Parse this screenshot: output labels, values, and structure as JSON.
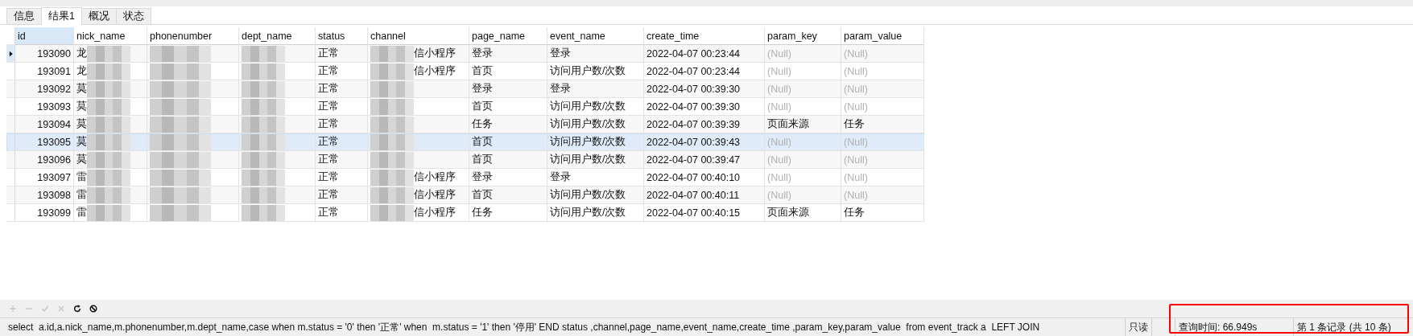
{
  "tabs": [
    {
      "label": "信息",
      "selected": false
    },
    {
      "label": "结果1",
      "selected": true
    },
    {
      "label": "概况",
      "selected": false
    },
    {
      "label": "状态",
      "selected": false
    }
  ],
  "table": {
    "columns": [
      {
        "label": "id",
        "selected": true
      },
      {
        "label": "nick_name",
        "selected": false
      },
      {
        "label": "phonenumber",
        "selected": false
      },
      {
        "label": "dept_name",
        "selected": false
      },
      {
        "label": "status",
        "selected": false
      },
      {
        "label": "channel",
        "selected": false
      },
      {
        "label": "page_name",
        "selected": false
      },
      {
        "label": "event_name",
        "selected": false
      },
      {
        "label": "create_time",
        "selected": false
      },
      {
        "label": "param_key",
        "selected": false
      },
      {
        "label": "param_value",
        "selected": false
      }
    ],
    "rows": [
      {
        "selected": true,
        "highlighted": false,
        "cells": [
          {
            "kind": "number",
            "text": "193090"
          },
          {
            "kind": "text",
            "text": "龙",
            "redacted": true
          },
          {
            "kind": "text",
            "redacted": true
          },
          {
            "kind": "text",
            "redacted": true
          },
          {
            "kind": "text",
            "text": "正常"
          },
          {
            "kind": "text",
            "text": "信小程序",
            "redacted": true
          },
          {
            "kind": "text",
            "text": "登录"
          },
          {
            "kind": "text",
            "text": "登录"
          },
          {
            "kind": "text",
            "text": "2022-04-07 00:23:44"
          },
          {
            "kind": "null",
            "text": "(Null)"
          },
          {
            "kind": "null",
            "text": "(Null)"
          }
        ]
      },
      {
        "selected": false,
        "highlighted": false,
        "cells": [
          {
            "kind": "number",
            "text": "193091"
          },
          {
            "kind": "text",
            "text": "龙",
            "redacted": true
          },
          {
            "kind": "text",
            "redacted": true
          },
          {
            "kind": "text",
            "redacted": true
          },
          {
            "kind": "text",
            "text": "正常"
          },
          {
            "kind": "text",
            "text": "信小程序",
            "redacted": true
          },
          {
            "kind": "text",
            "text": "首页"
          },
          {
            "kind": "text",
            "text": "访问用户数/次数"
          },
          {
            "kind": "text",
            "text": "2022-04-07 00:23:44"
          },
          {
            "kind": "null",
            "text": "(Null)"
          },
          {
            "kind": "null",
            "text": "(Null)"
          }
        ]
      },
      {
        "selected": false,
        "highlighted": false,
        "cells": [
          {
            "kind": "number",
            "text": "193092"
          },
          {
            "kind": "text",
            "text": "莫",
            "redacted": true
          },
          {
            "kind": "text",
            "redacted": true
          },
          {
            "kind": "text",
            "redacted": true
          },
          {
            "kind": "text",
            "text": "正常"
          },
          {
            "kind": "text",
            "redacted": true
          },
          {
            "kind": "text",
            "text": "登录"
          },
          {
            "kind": "text",
            "text": "登录"
          },
          {
            "kind": "text",
            "text": "2022-04-07 00:39:30"
          },
          {
            "kind": "null",
            "text": "(Null)"
          },
          {
            "kind": "null",
            "text": "(Null)"
          }
        ]
      },
      {
        "selected": false,
        "highlighted": false,
        "cells": [
          {
            "kind": "number",
            "text": "193093"
          },
          {
            "kind": "text",
            "text": "莫",
            "redacted": true
          },
          {
            "kind": "text",
            "redacted": true
          },
          {
            "kind": "text",
            "redacted": true
          },
          {
            "kind": "text",
            "text": "正常"
          },
          {
            "kind": "text",
            "redacted": true
          },
          {
            "kind": "text",
            "text": "首页"
          },
          {
            "kind": "text",
            "text": "访问用户数/次数"
          },
          {
            "kind": "text",
            "text": "2022-04-07 00:39:30"
          },
          {
            "kind": "null",
            "text": "(Null)"
          },
          {
            "kind": "null",
            "text": "(Null)"
          }
        ]
      },
      {
        "selected": false,
        "highlighted": false,
        "cells": [
          {
            "kind": "number",
            "text": "193094"
          },
          {
            "kind": "text",
            "text": "莫",
            "redacted": true
          },
          {
            "kind": "text",
            "redacted": true
          },
          {
            "kind": "text",
            "redacted": true
          },
          {
            "kind": "text",
            "text": "正常"
          },
          {
            "kind": "text",
            "redacted": true
          },
          {
            "kind": "text",
            "text": "任务"
          },
          {
            "kind": "text",
            "text": "访问用户数/次数"
          },
          {
            "kind": "text",
            "text": "2022-04-07 00:39:39"
          },
          {
            "kind": "text",
            "text": "页面来源"
          },
          {
            "kind": "text",
            "text": "任务"
          }
        ]
      },
      {
        "selected": false,
        "highlighted": true,
        "cells": [
          {
            "kind": "number",
            "text": "193095"
          },
          {
            "kind": "text",
            "text": "莫",
            "redacted": true
          },
          {
            "kind": "text",
            "redacted": true
          },
          {
            "kind": "text",
            "redacted": true
          },
          {
            "kind": "text",
            "text": "正常"
          },
          {
            "kind": "text",
            "redacted": true
          },
          {
            "kind": "text",
            "text": "首页"
          },
          {
            "kind": "text",
            "text": "访问用户数/次数"
          },
          {
            "kind": "text",
            "text": "2022-04-07 00:39:43"
          },
          {
            "kind": "null",
            "text": "(Null)"
          },
          {
            "kind": "null",
            "text": "(Null)"
          }
        ]
      },
      {
        "selected": false,
        "highlighted": false,
        "cells": [
          {
            "kind": "number",
            "text": "193096"
          },
          {
            "kind": "text",
            "text": "莫",
            "redacted": true
          },
          {
            "kind": "text",
            "redacted": true
          },
          {
            "kind": "text",
            "redacted": true
          },
          {
            "kind": "text",
            "text": "正常"
          },
          {
            "kind": "text",
            "redacted": true
          },
          {
            "kind": "text",
            "text": "首页"
          },
          {
            "kind": "text",
            "text": "访问用户数/次数"
          },
          {
            "kind": "text",
            "text": "2022-04-07 00:39:47"
          },
          {
            "kind": "null",
            "text": "(Null)"
          },
          {
            "kind": "null",
            "text": "(Null)"
          }
        ]
      },
      {
        "selected": false,
        "highlighted": false,
        "cells": [
          {
            "kind": "number",
            "text": "193097"
          },
          {
            "kind": "text",
            "text": "雷",
            "redacted": true
          },
          {
            "kind": "text",
            "redacted": true
          },
          {
            "kind": "text",
            "redacted": true
          },
          {
            "kind": "text",
            "text": "正常"
          },
          {
            "kind": "text",
            "text": "信小程序",
            "redacted": true
          },
          {
            "kind": "text",
            "text": "登录"
          },
          {
            "kind": "text",
            "text": "登录"
          },
          {
            "kind": "text",
            "text": "2022-04-07 00:40:10"
          },
          {
            "kind": "null",
            "text": "(Null)"
          },
          {
            "kind": "null",
            "text": "(Null)"
          }
        ]
      },
      {
        "selected": false,
        "highlighted": false,
        "cells": [
          {
            "kind": "number",
            "text": "193098"
          },
          {
            "kind": "text",
            "text": "雷",
            "redacted": true
          },
          {
            "kind": "text",
            "redacted": true
          },
          {
            "kind": "text",
            "redacted": true
          },
          {
            "kind": "text",
            "text": "正常"
          },
          {
            "kind": "text",
            "text": "信小程序",
            "redacted": true
          },
          {
            "kind": "text",
            "text": "首页"
          },
          {
            "kind": "text",
            "text": "访问用户数/次数"
          },
          {
            "kind": "text",
            "text": "2022-04-07 00:40:11"
          },
          {
            "kind": "null",
            "text": "(Null)"
          },
          {
            "kind": "null",
            "text": "(Null)"
          }
        ]
      },
      {
        "selected": false,
        "highlighted": false,
        "cells": [
          {
            "kind": "number",
            "text": "193099"
          },
          {
            "kind": "text",
            "text": "雷",
            "redacted": true
          },
          {
            "kind": "text",
            "redacted": true
          },
          {
            "kind": "text",
            "redacted": true
          },
          {
            "kind": "text",
            "text": "正常"
          },
          {
            "kind": "text",
            "text": "信小程序",
            "redacted": true
          },
          {
            "kind": "text",
            "text": "任务"
          },
          {
            "kind": "text",
            "text": "访问用户数/次数"
          },
          {
            "kind": "text",
            "text": "2022-04-07 00:40:15"
          },
          {
            "kind": "text",
            "text": "页面来源"
          },
          {
            "kind": "text",
            "text": "任务"
          }
        ]
      }
    ]
  },
  "toolbar": [
    {
      "kind": "add",
      "disabled": true
    },
    {
      "kind": "remove",
      "disabled": true
    },
    {
      "kind": "apply",
      "disabled": true
    },
    {
      "kind": "cancel",
      "disabled": true
    },
    {
      "kind": "refresh",
      "disabled": false
    },
    {
      "kind": "stop",
      "disabled": false
    }
  ],
  "status_bar": {
    "query": "select  a.id,a.nick_name,m.phonenumber,m.dept_name,case when m.status = '0' then '正常' when  m.status = '1' then '停用' END status ,channel,page_name,event_name,create_time ,param_key,param_value  from event_track a  LEFT JOIN",
    "mode": "只读",
    "query_time": "查询时间: 66.949s",
    "record": "第 1 条记录 (共 10 条)"
  },
  "annotation": {
    "kind": "box",
    "color": "#ff0000"
  }
}
